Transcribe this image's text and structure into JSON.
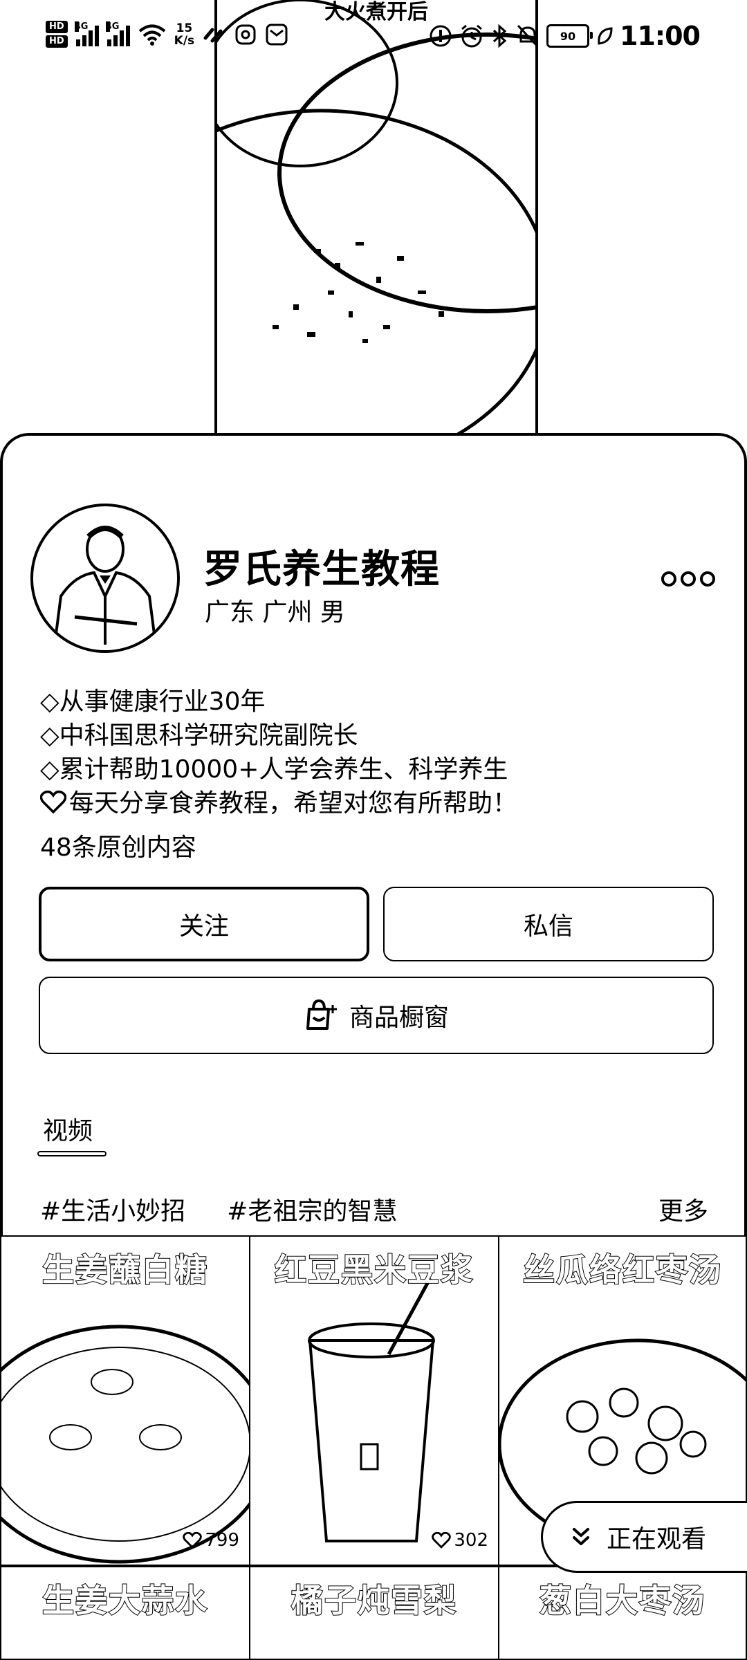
{
  "status_bar": {
    "hd1": "HD",
    "hd2": "HD",
    "net1": "4G",
    "net2": "4G",
    "speed_value": "15",
    "speed_unit": "K/s",
    "battery": "90",
    "time": "11:00"
  },
  "preview": {
    "title": "大火煮开后"
  },
  "profile": {
    "name": "罗氏养生教程",
    "location": "广东 广州 男",
    "bio": [
      "◇从事健康行业30年",
      "◇中科国思科学研究院副院长",
      "◇累计帮助10000+人学会养生、科学养生"
    ],
    "bio_last": "每天分享食养教程，希望对您有所帮助！",
    "content_count": "48条原创内容"
  },
  "actions": {
    "follow": "关注",
    "message": "私信",
    "shop": "商品橱窗"
  },
  "tabs": {
    "videos": "视频"
  },
  "tags": [
    "#生活小妙招",
    "#老祖宗的智慧"
  ],
  "more": "更多",
  "videos": [
    {
      "title": "生姜蘸白糖",
      "likes": "799"
    },
    {
      "title": "红豆黑米豆浆",
      "likes": "302"
    },
    {
      "title": "丝瓜络红枣汤",
      "likes": ""
    },
    {
      "title": "生姜大蒜水",
      "likes": ""
    },
    {
      "title": "橘子炖雪梨",
      "likes": ""
    },
    {
      "title": "葱白大枣汤",
      "likes": ""
    }
  ],
  "watching": "正在观看",
  "icons": {
    "more": "more-icon",
    "heart": "heart-icon",
    "shop": "shop-bag-icon",
    "chevron": "double-chevron-down-icon"
  }
}
